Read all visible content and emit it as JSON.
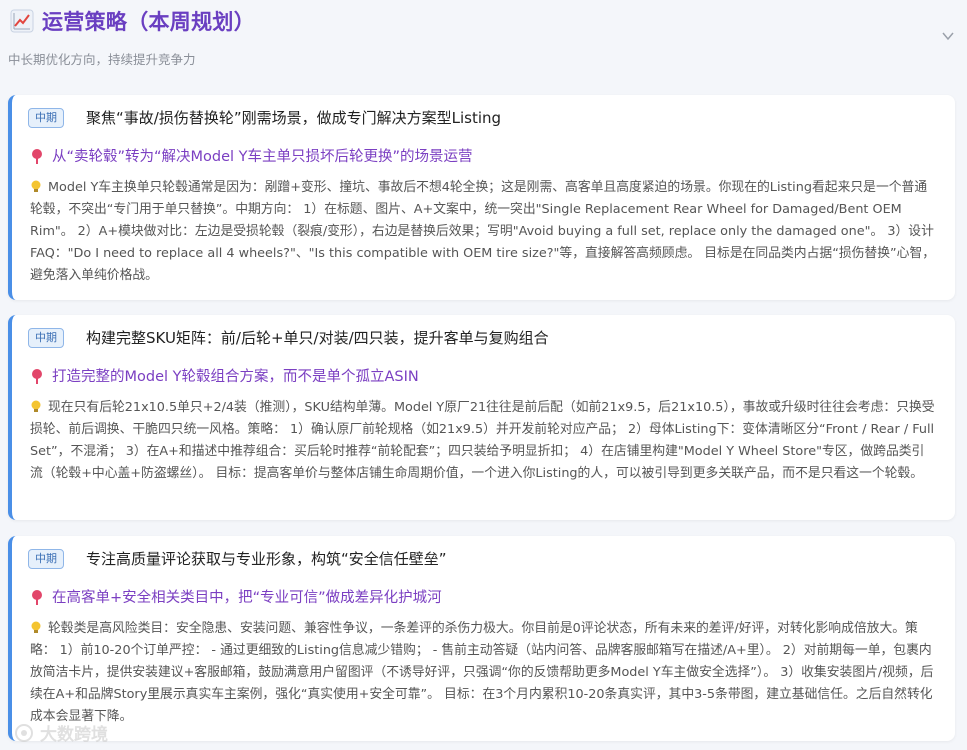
{
  "header": {
    "icon": "chart-increasing-icon",
    "title": "运营策略（本周规划）",
    "subtitle": "中长期优化方向，持续提升竞争力"
  },
  "cards": [
    {
      "badge": "中期",
      "title": "聚焦“事故/损伤替换轮”刚需场景，做成专门解决方案型Listing",
      "goal": "从“卖轮毂”转为“解决Model Y车主单只损坏后轮更换”的场景运营",
      "description": "Model Y车主换单只轮毂通常是因为：剐蹭+变形、撞坑、事故后不想4轮全换；这是刚需、高客单且高度紧迫的场景。你现在的Listing看起来只是一个普通轮毂，不突出“专门用于单只替换”。中期方向： 1）在标题、图片、A+文案中，统一突出\"Single Replacement Rear Wheel for Damaged/Bent OEM Rim\"。 2）A+模块做对比：左边是受损轮毂（裂痕/变形），右边是替换后效果；写明\"Avoid buying a full set, replace only the damaged one\"。 3）设计FAQ：\"Do I need to replace all 4 wheels?\"、\"Is this compatible with OEM tire size?\"等，直接解答高频顾虑。 目标是在同品类内占据“损伤替换”心智，避免落入单纯价格战。"
    },
    {
      "badge": "中期",
      "title": "构建完整SKU矩阵：前/后轮+单只/对装/四只装，提升客单与复购组合",
      "goal": "打造完整的Model Y轮毂组合方案，而不是单个孤立ASIN",
      "description": "现在只有后轮21x10.5单只+2/4装（推测），SKU结构单薄。Model Y原厂21往往是前后配（如前21x9.5，后21x10.5），事故或升级时往往会考虑：只换受损轮、前后调换、干脆四只统一风格。策略： 1）确认原厂前轮规格（如21x9.5）并开发前轮对应产品； 2）母体Listing下：变体清晰区分“Front / Rear / Full Set”，不混淆； 3）在A+和描述中推荐组合：买后轮时推荐“前轮配套”；四只装给予明显折扣； 4）在店铺里构建\"Model Y Wheel Store\"专区，做跨品类引流（轮毂+中心盖+防盗螺丝）。 目标：提高客单价与整体店铺生命周期价值，一个进入你Listing的人，可以被引导到更多关联产品，而不是只看这一个轮毂。"
    },
    {
      "badge": "中期",
      "title": "专注高质量评论获取与专业形象，构筑“安全信任壁垒”",
      "goal": "在高客单+安全相关类目中，把“专业可信”做成差异化护城河",
      "description": "轮毂类是高风险类目：安全隐患、安装问题、兼容性争议，一条差评的杀伤力极大。你目前是0评论状态，所有未来的差评/好评，对转化影响成倍放大。策略： 1）前10-20个订单严控： - 通过更细致的Listing信息减少错购； - 售前主动答疑（站内问答、品牌客服邮箱写在描述/A+里）。 2）对前期每一单，包裹内放简洁卡片，提供安装建议+客服邮箱，鼓励满意用户留图评（不诱导好评，只强调“你的反馈帮助更多Model Y车主做安全选择”）。 3）收集安装图片/视频，后续在A+和品牌Story里展示真实车主案例，强化“真实使用+安全可靠”。 目标：在3个月内累积10-20条真实评，其中3-5条带图，建立基础信任。之后自然转化成本会显著下降。"
    }
  ],
  "watermark": "大数跨境"
}
